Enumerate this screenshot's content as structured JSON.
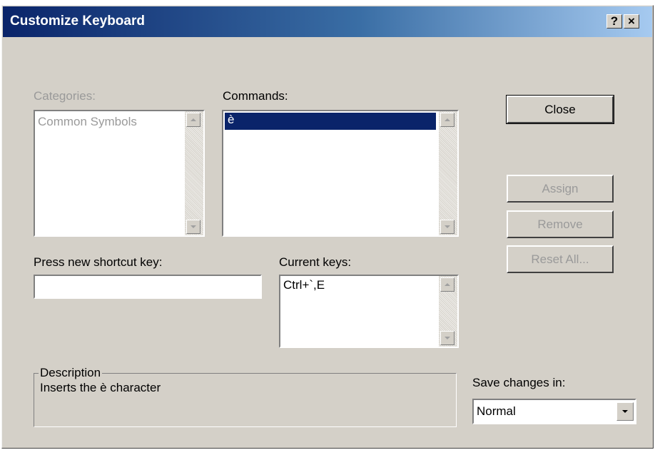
{
  "window": {
    "title": "Customize Keyboard",
    "help_glyph": "?",
    "close_glyph": "×"
  },
  "categories": {
    "label": "Categories:",
    "items": [
      "Common Symbols"
    ]
  },
  "commands": {
    "label": "Commands:",
    "items": [
      "è"
    ]
  },
  "buttons": {
    "close": "Close",
    "assign": "Assign",
    "remove": "Remove",
    "reset_all": "Reset All..."
  },
  "shortcut": {
    "label": "Press new shortcut key:",
    "value": ""
  },
  "current_keys": {
    "label": "Current keys:",
    "items": [
      "Ctrl+`,E"
    ]
  },
  "description": {
    "title": "Description",
    "text": "Inserts the è character"
  },
  "save_changes": {
    "label": "Save changes in:",
    "selected": "Normal"
  },
  "colors": {
    "dialog_bg": "#d4d0c8",
    "title_bar_start": "#0a246a",
    "selection": "#0a246a",
    "disabled_text": "#9a9a9a"
  }
}
